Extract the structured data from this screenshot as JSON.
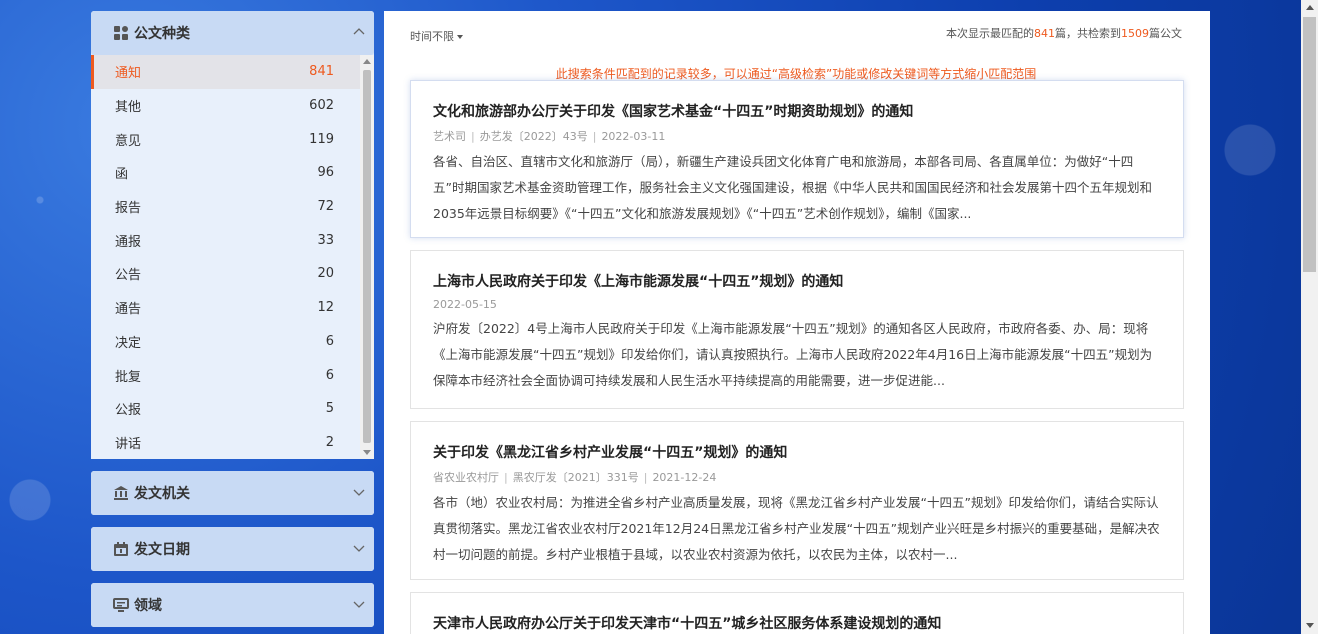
{
  "sidebar": {
    "doc_type": {
      "title": "公文种类",
      "items": [
        {
          "label": "通知",
          "count": "841",
          "active": true
        },
        {
          "label": "其他",
          "count": "602"
        },
        {
          "label": "意见",
          "count": "119"
        },
        {
          "label": "函",
          "count": "96"
        },
        {
          "label": "报告",
          "count": "72"
        },
        {
          "label": "通报",
          "count": "33"
        },
        {
          "label": "公告",
          "count": "20"
        },
        {
          "label": "通告",
          "count": "12"
        },
        {
          "label": "决定",
          "count": "6"
        },
        {
          "label": "批复",
          "count": "6"
        },
        {
          "label": "公报",
          "count": "5"
        },
        {
          "label": "讲话",
          "count": "2"
        }
      ]
    },
    "issuer": {
      "title": "发文机关"
    },
    "date": {
      "title": "发文日期"
    },
    "field": {
      "title": "领域"
    }
  },
  "main": {
    "time_filter": "时间不限",
    "summary_prefix": "本次显示最匹配的",
    "shown": "841",
    "summary_mid": "篇，共检索到",
    "total": "1509",
    "summary_suffix": "篇公文",
    "notice": "此搜索条件匹配到的记录较多，可以通过“高级检索”功能或修改关键词等方式缩小匹配范围",
    "results": [
      {
        "title": "文化和旅游部办公厅关于印发《国家艺术基金“十四五”时期资助规划》的通知",
        "meta": [
          "艺术司",
          "办艺发〔2022〕43号",
          "2022-03-11"
        ],
        "body": "各省、自治区、直辖市文化和旅游厅（局），新疆生产建设兵团文化体育广电和旅游局，本部各司局、各直属单位：为做好“十四五”时期国家艺术基金资助管理工作，服务社会主义文化强国建设，根据《中华人民共和国国民经济和社会发展第十四个五年规划和2035年远景目标纲要》《“十四五”文化和旅游发展规划》《“十四五”艺术创作规划》，编制《国家..."
      },
      {
        "title": "上海市人民政府关于印发《上海市能源发展“十四五”规划》的通知",
        "meta": [
          "2022-05-15"
        ],
        "body": "沪府发〔2022〕4号上海市人民政府关于印发《上海市能源发展“十四五”规划》的通知各区人民政府，市政府各委、办、局：现将《上海市能源发展“十四五”规划》印发给你们，请认真按照执行。上海市人民政府2022年4月16日上海市能源发展“十四五”规划为保障本市经济社会全面协调可持续发展和人民生活水平持续提高的用能需要，进一步促进能..."
      },
      {
        "title": "关于印发《黑龙江省乡村产业发展“十四五”规划》的通知",
        "meta": [
          "省农业农村厅",
          "黑农厅发〔2021〕331号",
          "2021-12-24"
        ],
        "body": "各市（地）农业农村局：为推进全省乡村产业高质量发展，现将《黑龙江省乡村产业发展“十四五”规划》印发给你们，请结合实际认真贯彻落实。黑龙江省农业农村厅2021年12月24日黑龙江省乡村产业发展“十四五”规划产业兴旺是乡村振兴的重要基础，是解决农村一切问题的前提。乡村产业根植于县域，以农业农村资源为依托，以农民为主体，以农村一..."
      },
      {
        "title": "天津市人民政府办公厅关于印发天津市“十四五”城乡社区服务体系建设规划的通知",
        "meta": [],
        "body": ""
      }
    ]
  }
}
